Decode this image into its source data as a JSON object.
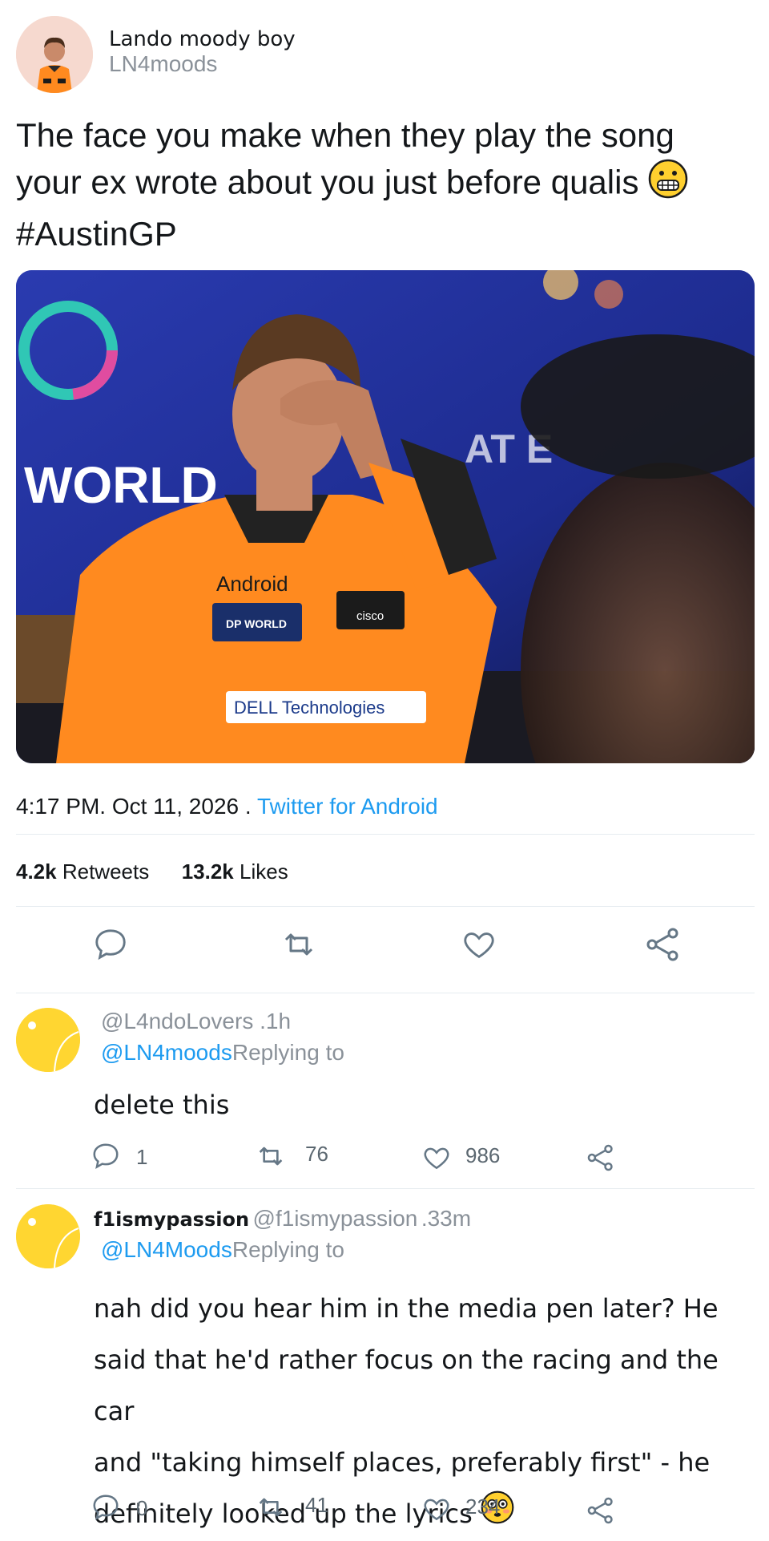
{
  "tweet": {
    "display_name": "Lando moody boy",
    "handle": "LN4moods",
    "text_line1": "The face you make when they play the song",
    "text_line2": "your ex wrote about you just before qualis",
    "hashtag": "#AustinGP",
    "time": "4:17 PM",
    "date": "Oct 11, 2026",
    "source": "Twitter for Android",
    "retweets_count": "4.2k",
    "retweets_label": "Retweets",
    "likes_count": "13.2k",
    "likes_label": "Likes"
  },
  "photo": {
    "sponsors": [
      "Android",
      "DP WORLD",
      "cisco",
      "DELL Technologies"
    ],
    "backdrop_text": "WORLD"
  },
  "replies": [
    {
      "handle": "@L4ndoLovers",
      "age": ".1h",
      "mention": "@LN4moods",
      "replying_to": "Replying to",
      "body": [
        "delete this"
      ],
      "comments": "1",
      "retweets": "76",
      "likes": "986"
    },
    {
      "name": "f1ismypassion",
      "handle": "@f1ismypassion",
      "age": ".33m",
      "mention": "@LN4Moods",
      "replying_to": "Replying to",
      "body": [
        "nah did you hear him in the media pen later? He",
        "said that he'd rather focus on the racing and the car",
        "and \"taking himself places, preferably first\" - he",
        "definitely looked up the lyrics"
      ],
      "comments": "0",
      "retweets": "41",
      "likes": "234"
    }
  ],
  "colors": {
    "link": "#1d9bf0",
    "muted": "#8a9199",
    "avatar_yellow": "#ffd631",
    "suit_orange": "#ff8a1f"
  },
  "icons": [
    "reply-icon",
    "retweet-icon",
    "like-icon",
    "share-icon",
    "grimacing-emoji-icon",
    "flushed-emoji-icon"
  ]
}
